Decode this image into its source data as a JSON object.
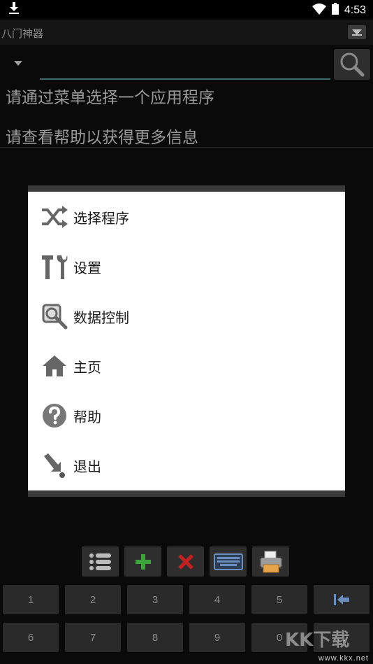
{
  "status_bar": {
    "time": "4:53"
  },
  "app": {
    "title": "八门神器"
  },
  "search": {
    "placeholder": ""
  },
  "hints": [
    "请通过菜单选择一个应用程序",
    "请查看帮助以获得更多信息"
  ],
  "menu": {
    "items": [
      {
        "label": "选择程序",
        "icon": "shuffle-icon"
      },
      {
        "label": "设置",
        "icon": "tools-icon"
      },
      {
        "label": "数据控制",
        "icon": "data-search-icon"
      },
      {
        "label": "主页",
        "icon": "home-icon"
      },
      {
        "label": "帮助",
        "icon": "help-icon"
      },
      {
        "label": "退出",
        "icon": "exit-icon"
      }
    ]
  },
  "toolbar": {
    "icons": [
      "list-icon",
      "add-icon",
      "delete-icon",
      "keyboard-icon",
      "printer-icon"
    ]
  },
  "keypad": {
    "row1": [
      "1",
      "2",
      "3",
      "4",
      "5"
    ],
    "row2": [
      "6",
      "7",
      "8",
      "9",
      "0",
      "..."
    ]
  },
  "watermark": {
    "logo_text": "KK下载",
    "url": "www.kkx.net"
  },
  "colors": {
    "accent_underline": "#3d6e6e",
    "add_green": "#3aa33a",
    "delete_red": "#c42020",
    "keyboard_blue": "#6a8fbf"
  }
}
